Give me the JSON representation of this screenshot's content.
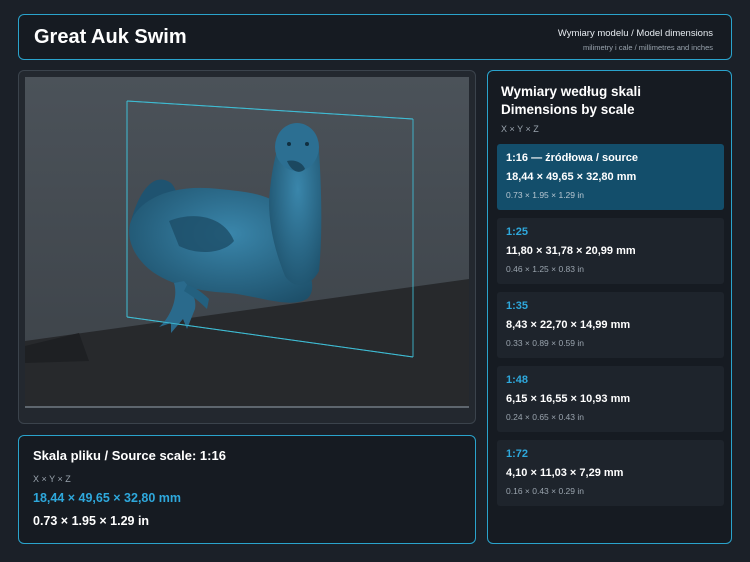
{
  "header": {
    "title": "Great Auk Swim",
    "subtitle": "Wymiary modelu / Model dimensions",
    "units_note": "milimetry i cale / millimetres and inches"
  },
  "viewport": {
    "model": "great auk figurine",
    "model_color": "#2b6b8c",
    "bbox_color": "#3fc0d8"
  },
  "source": {
    "heading": "Skala pliku / Source scale: 1:16",
    "axes": "X × Y × Z",
    "mm": "18,44 × 49,65 × 32,80 mm",
    "inches": "0.73 × 1.95 × 1.29 in"
  },
  "scales": {
    "heading_line1": "Wymiary według skali",
    "heading_line2": "Dimensions by scale",
    "axes": "X × Y × Z",
    "items": [
      {
        "scale": "1:16  —  źródłowa / source",
        "mm": "18,44 × 49,65 × 32,80 mm",
        "inches": "0.73 × 1.95 × 1.29 in",
        "active": true
      },
      {
        "scale": "1:25",
        "mm": "11,80 × 31,78 × 20,99 mm",
        "inches": "0.46 × 1.25 × 0.83 in",
        "active": false
      },
      {
        "scale": "1:35",
        "mm": "8,43 × 22,70 × 14,99 mm",
        "inches": "0.33 × 0.89 × 0.59 in",
        "active": false
      },
      {
        "scale": "1:48",
        "mm": "6,15 × 16,55 × 10,93 mm",
        "inches": "0.24 × 0.65 × 0.43 in",
        "active": false
      },
      {
        "scale": "1:72",
        "mm": "4,10 × 11,03 × 7,29 mm",
        "inches": "0.16 × 0.43 × 0.29 in",
        "active": false
      }
    ]
  }
}
